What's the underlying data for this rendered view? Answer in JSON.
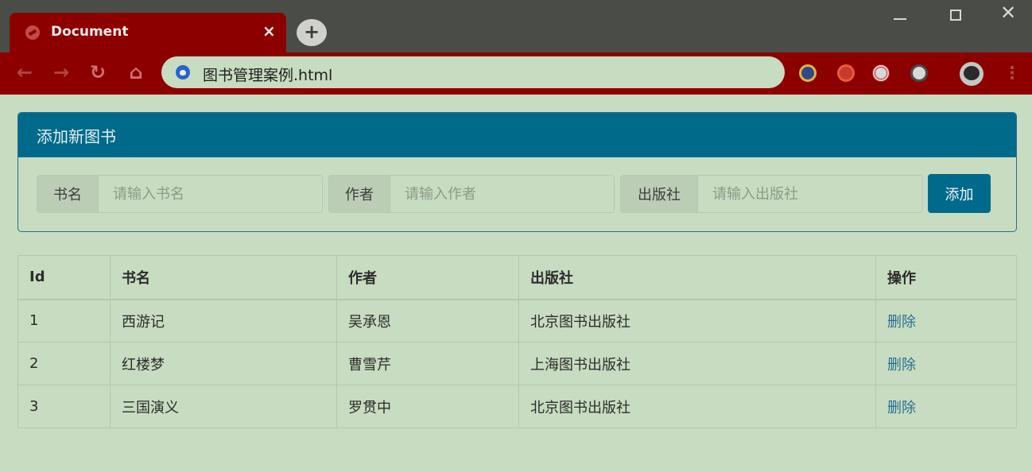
{
  "browser": {
    "tab_title": "Document",
    "tab_close": "×",
    "new_tab": "+",
    "url": "图书管理案例.html"
  },
  "panel": {
    "title": "添加新图书",
    "fields": {
      "name_label": "书名",
      "name_placeholder": "请输入书名",
      "author_label": "作者",
      "author_placeholder": "请输入作者",
      "publisher_label": "出版社",
      "publisher_placeholder": "请输入出版社"
    },
    "add_button": "添加"
  },
  "table": {
    "headers": {
      "id": "Id",
      "name": "书名",
      "author": "作者",
      "publisher": "出版社",
      "action": "操作"
    },
    "rows": [
      {
        "id": "1",
        "name": "西游记",
        "author": "吴承恩",
        "publisher": "北京图书出版社",
        "action": "删除"
      },
      {
        "id": "2",
        "name": "红楼梦",
        "author": "曹雪芹",
        "publisher": "上海图书出版社",
        "action": "删除"
      },
      {
        "id": "3",
        "name": "三国演义",
        "author": "罗贯中",
        "publisher": "北京图书出版社",
        "action": "删除"
      }
    ]
  },
  "colors": {
    "chrome_accent": "#8c0000",
    "panel_header": "#006a8b",
    "page_background": "#c7dcc0",
    "link": "#2b6f93"
  }
}
